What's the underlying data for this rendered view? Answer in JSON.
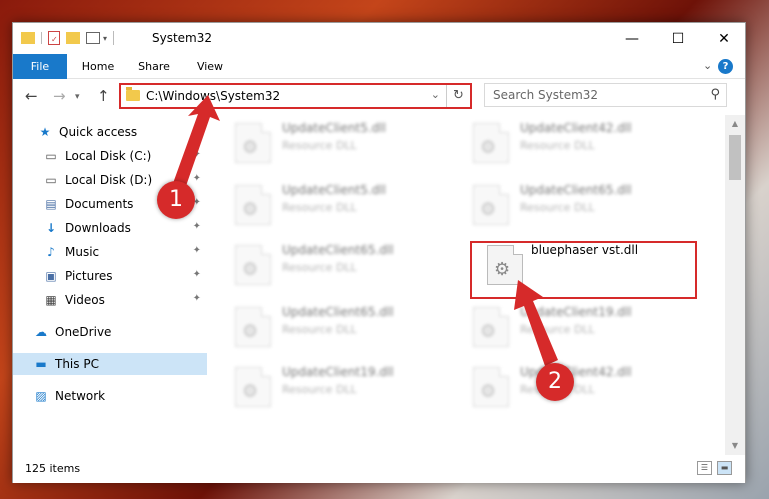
{
  "window": {
    "title": "System32",
    "controls": {
      "minimize": "—",
      "maximize": "☐",
      "close": "✕"
    }
  },
  "ribbon": {
    "tabs": [
      "File",
      "Home",
      "Share",
      "View"
    ],
    "help_label": "?"
  },
  "navigation": {
    "back": "←",
    "forward": "→",
    "up": "↑",
    "address": "C:\\Windows\\System32",
    "refresh": "↻",
    "search_placeholder": "Search System32"
  },
  "sidebar": {
    "items": [
      {
        "label": "Quick access",
        "icon": "star-icon",
        "glyph": "★",
        "color": "#1979ca"
      },
      {
        "label": "Local Disk (C:)",
        "icon": "drive-icon",
        "glyph": "▭",
        "color": "#555"
      },
      {
        "label": "Local Disk (D:)",
        "icon": "drive-icon",
        "glyph": "▭",
        "color": "#555"
      },
      {
        "label": "Documents",
        "icon": "documents-icon",
        "glyph": "▤",
        "color": "#4a6fa5"
      },
      {
        "label": "Downloads",
        "icon": "downloads-icon",
        "glyph": "↓",
        "color": "#1979ca"
      },
      {
        "label": "Music",
        "icon": "music-icon",
        "glyph": "♪",
        "color": "#1979ca"
      },
      {
        "label": "Pictures",
        "icon": "pictures-icon",
        "glyph": "▣",
        "color": "#4a6fa5"
      },
      {
        "label": "Videos",
        "icon": "videos-icon",
        "glyph": "▦",
        "color": "#444"
      },
      {
        "label": "OneDrive",
        "icon": "onedrive-icon",
        "glyph": "☁",
        "color": "#1979ca"
      },
      {
        "label": "This PC",
        "icon": "computer-icon",
        "glyph": "▬",
        "color": "#1979ca"
      },
      {
        "label": "Network",
        "icon": "network-icon",
        "glyph": "▨",
        "color": "#1979ca"
      }
    ]
  },
  "files": [
    {
      "name": "UpdateClient5.dll",
      "type": "Resource DLL"
    },
    {
      "name": "UpdateClient42.dll",
      "type": "Resource DLL"
    },
    {
      "name": "UpdateClient5.dll",
      "type": "Resource DLL"
    },
    {
      "name": "UpdateClient65.dll",
      "type": "Resource DLL"
    },
    {
      "name": "UpdateClient65.dll",
      "type": "Resource DLL"
    },
    {
      "name": "bluephaser vst.dll",
      "type": ""
    },
    {
      "name": "UpdateClient65.dll",
      "type": "Resource DLL"
    },
    {
      "name": "UpdateClient19.dll",
      "type": "Resource DLL"
    },
    {
      "name": "UpdateClient19.dll",
      "type": "Resource DLL"
    },
    {
      "name": "UpdateClient42.dll",
      "type": "Resource DLL"
    }
  ],
  "status": {
    "item_count": "125 items"
  },
  "annotations": {
    "step1": "1",
    "step2": "2",
    "color": "#d62a2a"
  }
}
